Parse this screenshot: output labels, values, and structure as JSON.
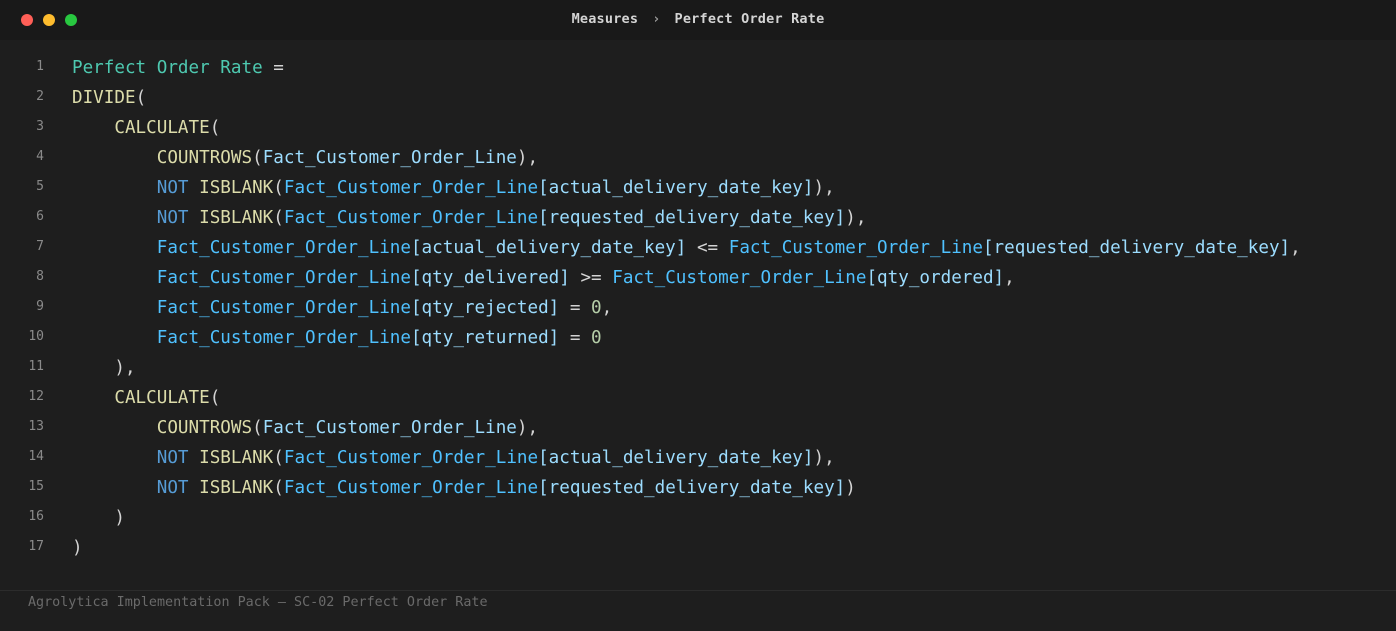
{
  "window": {
    "controls": [
      {
        "name": "close",
        "color": "#ff5f57"
      },
      {
        "name": "minimize",
        "color": "#febc2e"
      },
      {
        "name": "zoom",
        "color": "#28c840"
      }
    ],
    "breadcrumb": [
      "Measures",
      "Perfect Order Rate"
    ],
    "breadcrumb_separator": "›"
  },
  "editor": {
    "lines": [
      {
        "n": "1",
        "tokens": [
          {
            "t": "Perfect Order Rate",
            "k": "name"
          },
          {
            "t": " =",
            "k": "op"
          }
        ]
      },
      {
        "n": "2",
        "tokens": [
          {
            "t": "DIVIDE",
            "k": "fn"
          },
          {
            "t": "(",
            "k": "punct"
          }
        ]
      },
      {
        "n": "3",
        "tokens": [
          {
            "t": "    ",
            "k": "punct"
          },
          {
            "t": "CALCULATE",
            "k": "fn"
          },
          {
            "t": "(",
            "k": "punct"
          }
        ]
      },
      {
        "n": "4",
        "tokens": [
          {
            "t": "        ",
            "k": "punct"
          },
          {
            "t": "COUNTROWS",
            "k": "fn"
          },
          {
            "t": "(",
            "k": "punct"
          },
          {
            "t": "Fact_Customer_Order_Line",
            "k": "col"
          },
          {
            "t": "),",
            "k": "punct"
          }
        ]
      },
      {
        "n": "5",
        "tokens": [
          {
            "t": "        ",
            "k": "punct"
          },
          {
            "t": "NOT",
            "k": "kw"
          },
          {
            "t": " ",
            "k": "punct"
          },
          {
            "t": "ISBLANK",
            "k": "fn"
          },
          {
            "t": "(",
            "k": "punct"
          },
          {
            "t": "Fact_Customer_Order_Line",
            "k": "tbl"
          },
          {
            "t": "[actual_delivery_date_key]",
            "k": "col"
          },
          {
            "t": "),",
            "k": "punct"
          }
        ]
      },
      {
        "n": "6",
        "tokens": [
          {
            "t": "        ",
            "k": "punct"
          },
          {
            "t": "NOT",
            "k": "kw"
          },
          {
            "t": " ",
            "k": "punct"
          },
          {
            "t": "ISBLANK",
            "k": "fn"
          },
          {
            "t": "(",
            "k": "punct"
          },
          {
            "t": "Fact_Customer_Order_Line",
            "k": "tbl"
          },
          {
            "t": "[requested_delivery_date_key]",
            "k": "col"
          },
          {
            "t": "),",
            "k": "punct"
          }
        ]
      },
      {
        "n": "7",
        "tokens": [
          {
            "t": "        ",
            "k": "punct"
          },
          {
            "t": "Fact_Customer_Order_Line",
            "k": "tbl"
          },
          {
            "t": "[actual_delivery_date_key]",
            "k": "col"
          },
          {
            "t": " <= ",
            "k": "op"
          },
          {
            "t": "Fact_Customer_Order_Line",
            "k": "tbl"
          },
          {
            "t": "[requested_delivery_date_key]",
            "k": "col"
          },
          {
            "t": ",",
            "k": "punct"
          }
        ]
      },
      {
        "n": "8",
        "tokens": [
          {
            "t": "        ",
            "k": "punct"
          },
          {
            "t": "Fact_Customer_Order_Line",
            "k": "tbl"
          },
          {
            "t": "[qty_delivered]",
            "k": "col"
          },
          {
            "t": " >= ",
            "k": "op"
          },
          {
            "t": "Fact_Customer_Order_Line",
            "k": "tbl"
          },
          {
            "t": "[qty_ordered]",
            "k": "col"
          },
          {
            "t": ",",
            "k": "punct"
          }
        ]
      },
      {
        "n": "9",
        "tokens": [
          {
            "t": "        ",
            "k": "punct"
          },
          {
            "t": "Fact_Customer_Order_Line",
            "k": "tbl"
          },
          {
            "t": "[qty_rejected]",
            "k": "col"
          },
          {
            "t": " = ",
            "k": "op"
          },
          {
            "t": "0",
            "k": "num"
          },
          {
            "t": ",",
            "k": "punct"
          }
        ]
      },
      {
        "n": "10",
        "tokens": [
          {
            "t": "        ",
            "k": "punct"
          },
          {
            "t": "Fact_Customer_Order_Line",
            "k": "tbl"
          },
          {
            "t": "[qty_returned]",
            "k": "col"
          },
          {
            "t": " = ",
            "k": "op"
          },
          {
            "t": "0",
            "k": "num"
          }
        ]
      },
      {
        "n": "11",
        "tokens": [
          {
            "t": "    ),",
            "k": "punct"
          }
        ]
      },
      {
        "n": "12",
        "tokens": [
          {
            "t": "    ",
            "k": "punct"
          },
          {
            "t": "CALCULATE",
            "k": "fn"
          },
          {
            "t": "(",
            "k": "punct"
          }
        ]
      },
      {
        "n": "13",
        "tokens": [
          {
            "t": "        ",
            "k": "punct"
          },
          {
            "t": "COUNTROWS",
            "k": "fn"
          },
          {
            "t": "(",
            "k": "punct"
          },
          {
            "t": "Fact_Customer_Order_Line",
            "k": "col"
          },
          {
            "t": "),",
            "k": "punct"
          }
        ]
      },
      {
        "n": "14",
        "tokens": [
          {
            "t": "        ",
            "k": "punct"
          },
          {
            "t": "NOT",
            "k": "kw"
          },
          {
            "t": " ",
            "k": "punct"
          },
          {
            "t": "ISBLANK",
            "k": "fn"
          },
          {
            "t": "(",
            "k": "punct"
          },
          {
            "t": "Fact_Customer_Order_Line",
            "k": "tbl"
          },
          {
            "t": "[actual_delivery_date_key]",
            "k": "col"
          },
          {
            "t": "),",
            "k": "punct"
          }
        ]
      },
      {
        "n": "15",
        "tokens": [
          {
            "t": "        ",
            "k": "punct"
          },
          {
            "t": "NOT",
            "k": "kw"
          },
          {
            "t": " ",
            "k": "punct"
          },
          {
            "t": "ISBLANK",
            "k": "fn"
          },
          {
            "t": "(",
            "k": "punct"
          },
          {
            "t": "Fact_Customer_Order_Line",
            "k": "tbl"
          },
          {
            "t": "[requested_delivery_date_key]",
            "k": "col"
          },
          {
            "t": ")",
            "k": "punct"
          }
        ]
      },
      {
        "n": "16",
        "tokens": [
          {
            "t": "    )",
            "k": "punct"
          }
        ]
      },
      {
        "n": "17",
        "tokens": [
          {
            "t": ")",
            "k": "punct"
          }
        ]
      }
    ]
  },
  "footer": {
    "text": "Agrolytica Implementation Pack — SC-02 Perfect Order Rate"
  }
}
